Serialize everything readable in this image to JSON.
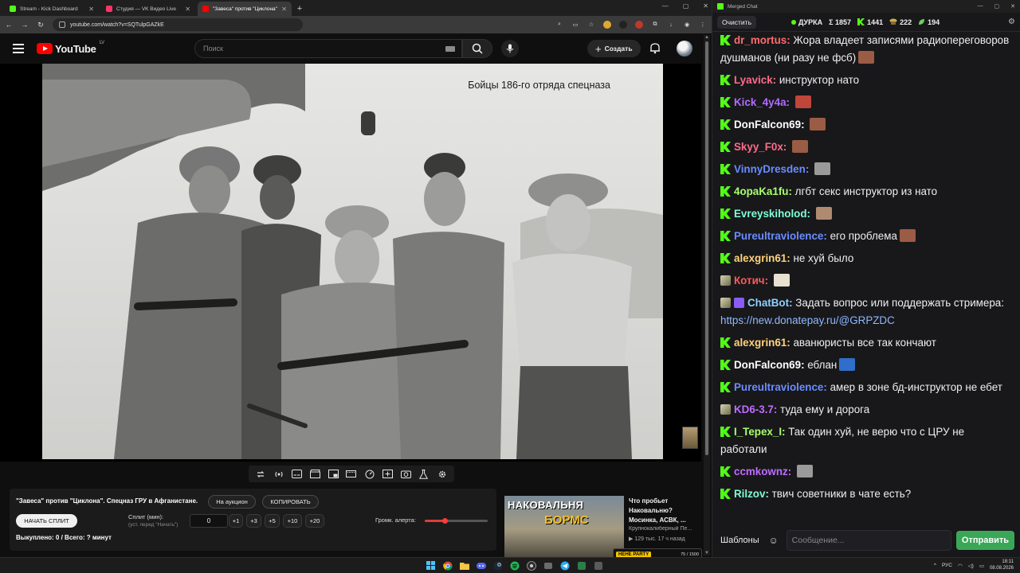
{
  "browser": {
    "tabs": [
      {
        "title": "Stream - Kick Dashboard",
        "color": "#53fc18",
        "active": false
      },
      {
        "title": "Студия — VK Видео Live",
        "color": "#ff3366",
        "active": false
      },
      {
        "title": "\"Завеса\" против \"Циклона\"",
        "color": "#ff0000",
        "active": true
      }
    ],
    "new_tab": "+",
    "url": "youtube.com/watch?v=SQTulpGAZkE"
  },
  "youtube": {
    "logo_text": "YouTube",
    "region": "LV",
    "search_placeholder": "Поиск",
    "create_label": "Создать"
  },
  "video": {
    "caption": "Бойцы 186-го отряда спецназа"
  },
  "split_panel": {
    "title": "\"Завеса\" против \"Циклона\". Спецназ ГРУ в Афганистане.",
    "auction_label": "На аукцион",
    "copy_label": "КОПИРОВАТЬ",
    "start_label": "НАЧАТЬ СПЛИТ",
    "split_label": "Сплит (мин):",
    "split_hint": "(уст. перед \"Начать\")",
    "split_value": "0",
    "increments": [
      "+1",
      "+3",
      "+5",
      "+10",
      "+20"
    ],
    "alert_label": "Громк. алерта:",
    "alert_volume": 0.32,
    "bought": "Выкуплено: 0 / Всего: ? минут"
  },
  "recommendation": {
    "thumb_line1": "НАКОВАЛЬНЯ",
    "thumb_line2": "БОРМС",
    "title": "Что пробьет Наковальню? Мосинка, АСВК, ...",
    "channel": "Крупнокалиберный Пе...",
    "meta": "▶ 129 тыс.   17 ч назад",
    "badge_label": "НЕНЕ PARTY",
    "badge_count": "75 / 1500"
  },
  "chat": {
    "window_title": "Merged Chat",
    "clear_label": "Очистить",
    "stats": [
      {
        "icon": "dot",
        "value": "ДУРКА"
      },
      {
        "icon": "sigma",
        "value": "Σ 1857"
      },
      {
        "icon": "kick",
        "value": "1441"
      },
      {
        "icon": "vk",
        "value": "222"
      },
      {
        "icon": "leaf",
        "value": "194"
      }
    ],
    "messages": [
      {
        "badge": "k",
        "user": "dr_mortus",
        "color": "#ff6b6b",
        "text": "Жора владеет записями радиопереговоров душманов (ни разу не фсб)",
        "emote": "#9a5c44"
      },
      {
        "badge": "k",
        "user": "Lyavick",
        "color": "#ff6b8a",
        "text": "инструктор нато",
        "emote": ""
      },
      {
        "badge": "k",
        "user": "Kick_4y4a",
        "color": "#b06cff",
        "text": "",
        "emote": "#c0453a"
      },
      {
        "badge": "k",
        "user": "DonFalcon69",
        "color": "#ffffff",
        "text": "",
        "emote": "#9a5c44"
      },
      {
        "badge": "k",
        "user": "Skyy_F0x",
        "color": "#ff6b8a",
        "text": "",
        "emote": "#9a5c44"
      },
      {
        "badge": "k",
        "user": "VinnyDresden",
        "color": "#6a8cff",
        "text": "",
        "emote": "#9a9a9a"
      },
      {
        "badge": "k",
        "user": "4opaKa1fu",
        "color": "#a8ff6b",
        "text": "лгбт секс инструктор из нато",
        "emote": ""
      },
      {
        "badge": "k",
        "user": "Evreyskiholod",
        "color": "#7fffd4",
        "text": "",
        "emote": "#b08a70"
      },
      {
        "badge": "k",
        "user": "Pureultraviolence",
        "color": "#6a8cff",
        "text": "его проблема",
        "emote": "#9a5c44"
      },
      {
        "badge": "k",
        "user": "alexgrin61",
        "color": "#ffd37a",
        "text": "не хуй было",
        "emote": ""
      },
      {
        "badge": "sub",
        "user": "Котич",
        "color": "#ff5a5a",
        "text": "",
        "emote": "#e8e0d0"
      },
      {
        "badge": "bot",
        "user": "ChatBot",
        "color": "#8fd0ff",
        "text": "Задать вопрос или поддержать стримера: ",
        "link": "https://new.donatepay.ru/@GRPZDC",
        "emote": ""
      },
      {
        "badge": "k",
        "user": "alexgrin61",
        "color": "#ffd37a",
        "text": "аванюристы все так кончают",
        "emote": ""
      },
      {
        "badge": "k",
        "user": "DonFalcon69",
        "color": "#ffffff",
        "text": "еблан",
        "emote": "#2f6ec9"
      },
      {
        "badge": "k",
        "user": "Pureultraviolence",
        "color": "#6a8cff",
        "text": "амер в зоне бд-инструктор не ебет",
        "emote": ""
      },
      {
        "badge": "sub",
        "user": "KD6-3.7",
        "color": "#c06cff",
        "text": "туда ему и дорога",
        "emote": ""
      },
      {
        "badge": "k",
        "user": "I_Tepex_I",
        "color": "#a8ff6b",
        "text": "Так один хуй, не верю что с ЦРУ не работали",
        "emote": ""
      },
      {
        "badge": "k",
        "user": "ccmkownz",
        "color": "#c06cff",
        "text": "",
        "emote": "#9a9a9a"
      },
      {
        "badge": "k",
        "user": "Rilzov",
        "color": "#7fffd4",
        "text": "твич советники в чате есть?",
        "emote": ""
      }
    ],
    "templates_label": "Шаблоны",
    "input_placeholder": "Сообщение...",
    "send_label": "Отправить"
  },
  "taskbar": {
    "lang": "РУС",
    "time": "18:11",
    "date": "08.08.2026"
  },
  "colors": {
    "kick_green": "#53fc18",
    "yt_red": "#ff0000",
    "send_green": "#3aa757"
  }
}
